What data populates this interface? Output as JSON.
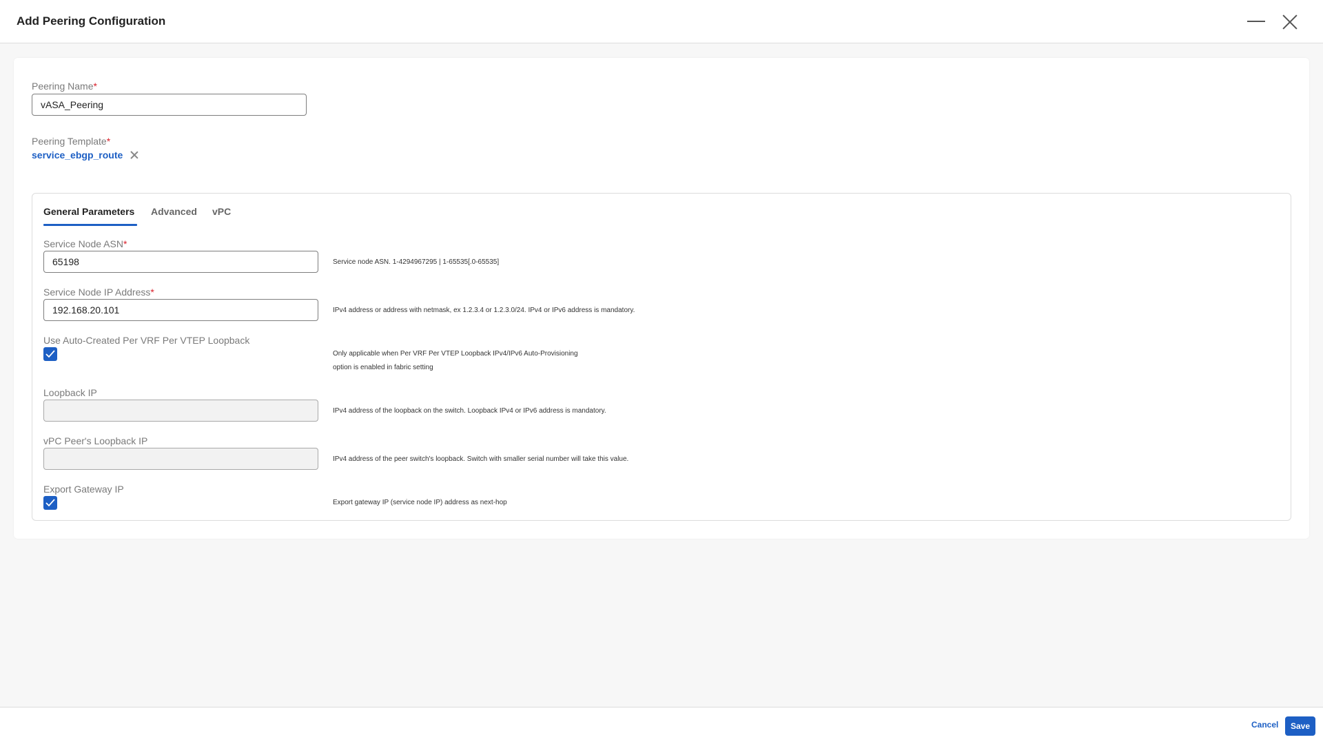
{
  "dialog": {
    "title": "Add Peering Configuration"
  },
  "peering_name": {
    "label": "Peering Name",
    "required": "*",
    "value": "vASA_Peering"
  },
  "peering_template": {
    "label": "Peering Template",
    "required": "*",
    "value": "service_ebgp_route"
  },
  "tabs": [
    {
      "label": "General Parameters",
      "active": true
    },
    {
      "label": "Advanced",
      "active": false
    },
    {
      "label": "vPC",
      "active": false
    }
  ],
  "fields": {
    "asn": {
      "label": "Service Node ASN",
      "required": "*",
      "value": "65198",
      "hint": "Service node ASN. 1-4294967295 | 1-65535[.0-65535]"
    },
    "ip": {
      "label": "Service Node IP Address",
      "required": "*",
      "value": "192.168.20.101",
      "hint": "IPv4 address or address with netmask, ex 1.2.3.4 or 1.2.3.0/24. IPv4 or IPv6 address is mandatory."
    },
    "auto_loopback": {
      "label": "Use Auto-Created Per VRF Per VTEP Loopback",
      "checked": true,
      "hint_line1": "Only applicable when Per VRF Per VTEP Loopback IPv4/IPv6 Auto-Provisioning",
      "hint_line2": "option is enabled in fabric setting"
    },
    "loopback_ip": {
      "label": "Loopback IP",
      "value": "",
      "hint": "IPv4 address of the loopback on the switch. Loopback IPv4 or IPv6 address is mandatory."
    },
    "vpc_peer_loopback_ip": {
      "label": "vPC Peer's Loopback IP",
      "value": "",
      "hint": "IPv4 address of the peer switch's loopback. Switch with smaller serial number will take this value."
    },
    "export_gateway": {
      "label": "Export Gateway IP",
      "checked": true,
      "hint": "Export gateway IP (service node IP) address as next-hop"
    }
  },
  "footer": {
    "cancel_label": "Cancel",
    "save_label": "Save"
  },
  "colors": {
    "accent": "#1d5fc4",
    "required": "#d91f2a"
  },
  "icons": {
    "minimize": "minimize-icon",
    "close": "close-icon",
    "remove": "remove-x-icon",
    "check": "check-icon"
  }
}
